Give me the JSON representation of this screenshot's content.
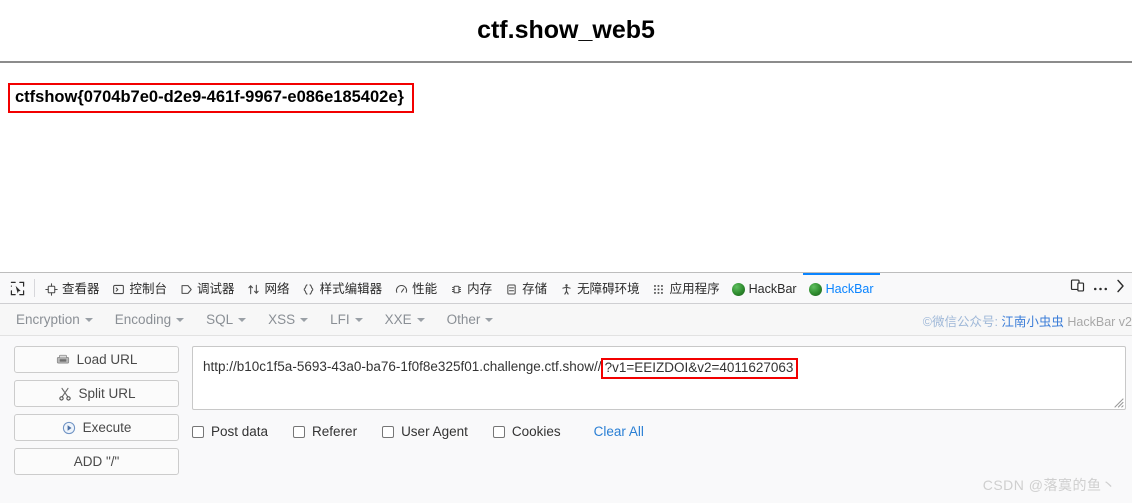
{
  "page": {
    "title": "ctf.show_web5",
    "flag": "ctfshow{0704b7e0-d2e9-461f-9967-e086e185402e}",
    "flag_box_color": "#f20000"
  },
  "devtools": {
    "picker_icon": "element-picker-icon",
    "tabs": [
      {
        "label": "查看器",
        "icon": "inspector-icon",
        "active": false
      },
      {
        "label": "控制台",
        "icon": "console-icon",
        "active": false
      },
      {
        "label": "调试器",
        "icon": "debugger-icon",
        "active": false
      },
      {
        "label": "网络",
        "icon": "network-icon",
        "active": false
      },
      {
        "label": "样式编辑器",
        "icon": "style-editor-icon",
        "active": false
      },
      {
        "label": "性能",
        "icon": "performance-icon",
        "active": false
      },
      {
        "label": "内存",
        "icon": "memory-icon",
        "active": false
      },
      {
        "label": "存储",
        "icon": "storage-icon",
        "active": false
      },
      {
        "label": "无障碍环境",
        "icon": "accessibility-icon",
        "active": false
      },
      {
        "label": "应用程序",
        "icon": "application-icon",
        "active": false
      },
      {
        "label": "HackBar",
        "icon": "hackbar-ext-icon",
        "active": false
      },
      {
        "label": "HackBar",
        "icon": "hackbar-ext-icon",
        "active": true
      }
    ],
    "active_tab_color": "#0a84ff",
    "right_icons": [
      {
        "name": "responsive-design-mode-icon",
        "glyph": "responsive"
      },
      {
        "name": "devtools-options-icon",
        "glyph": "…"
      },
      {
        "name": "devtools-overflow-chevron-icon",
        "glyph": "›"
      }
    ]
  },
  "hackbar": {
    "menus": [
      {
        "label": "Encryption"
      },
      {
        "label": "Encoding"
      },
      {
        "label": "SQL"
      },
      {
        "label": "XSS"
      },
      {
        "label": "LFI"
      },
      {
        "label": "XXE"
      },
      {
        "label": "Other"
      }
    ],
    "credit": {
      "prefix": "©微信公众号: ",
      "name": "江南小虫虫",
      "version": " HackBar v2"
    },
    "buttons": [
      {
        "label": "Load URL",
        "icon": "load-url-icon"
      },
      {
        "label": "Split URL",
        "icon": "split-url-icon"
      },
      {
        "label": "Execute",
        "icon": "execute-icon"
      },
      {
        "label": "ADD \"/\"",
        "icon": ""
      }
    ],
    "url": {
      "base": "http://b10c1f5a-5693-43a0-ba76-1f0f8e325f01.challenge.ctf.show/",
      "separator": "/",
      "query": "?v1=EEIZDOI&v2=4011627063",
      "query_highlight_color": "#f20000"
    },
    "options": [
      {
        "label": "Post data",
        "checked": false
      },
      {
        "label": "Referer",
        "checked": false
      },
      {
        "label": "User Agent",
        "checked": false
      },
      {
        "label": "Cookies",
        "checked": false
      }
    ],
    "clear_all_label": "Clear All",
    "clear_all_color": "#2a7fd4"
  },
  "watermark": "CSDN @落寞的鱼丶"
}
